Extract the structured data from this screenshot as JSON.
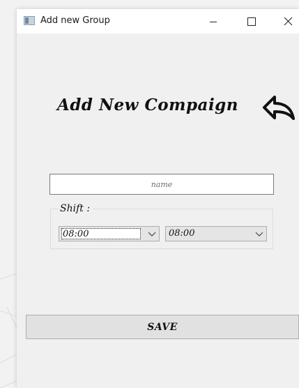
{
  "window": {
    "title": "Add new Group"
  },
  "form": {
    "heading": "Add New Compaign",
    "name_placeholder": "name",
    "shift_label": "Shift :",
    "shift_start": "08:00",
    "shift_end": "08:00",
    "save_label": "SAVE"
  },
  "icons": {
    "app": "app-window-icon",
    "minimize": "minimize-icon",
    "maximize": "maximize-icon",
    "close": "close-icon",
    "back": "back-arrow-icon",
    "dropdown": "chevron-down-icon"
  },
  "colors": {
    "window_bg": "#f0f0f0",
    "titlebar_bg": "#ffffff",
    "button_bg": "#e1e1e1",
    "border": "#adadad"
  }
}
